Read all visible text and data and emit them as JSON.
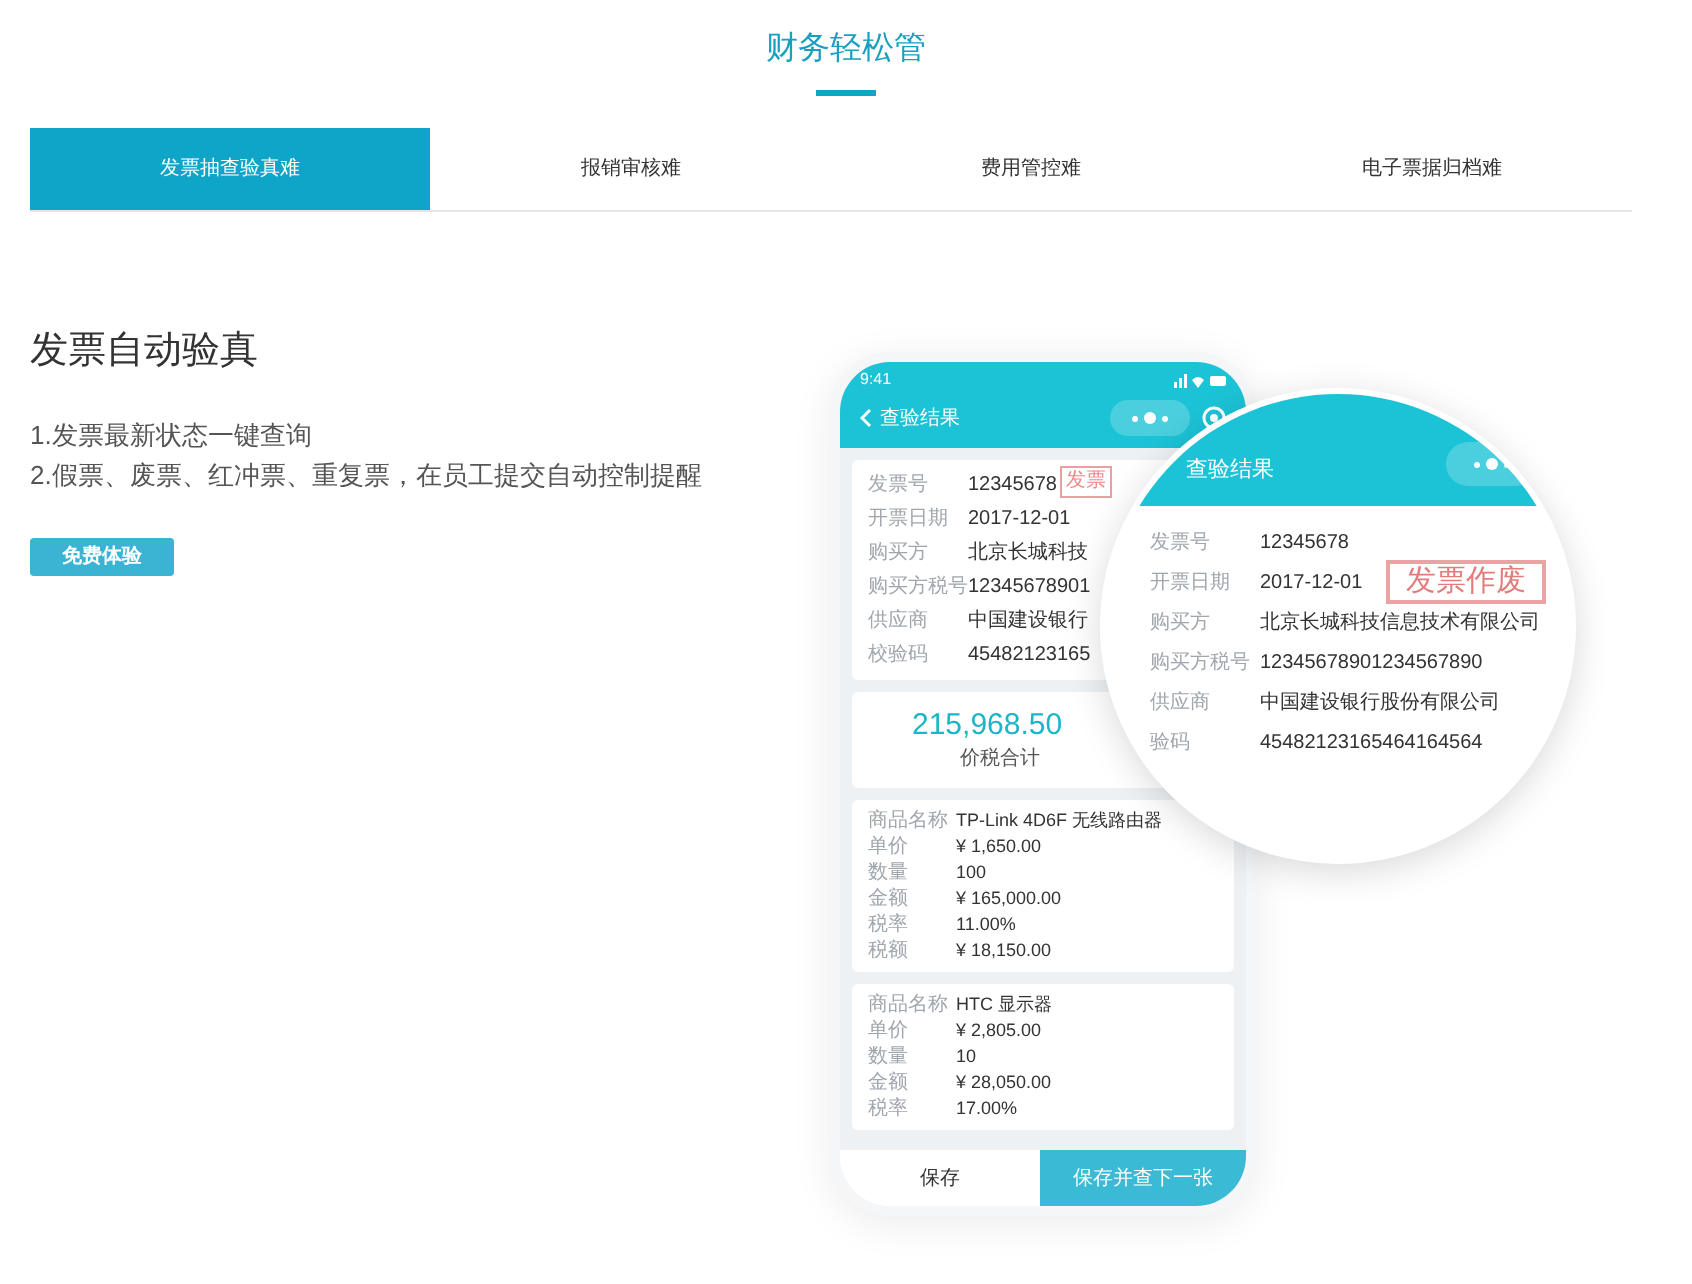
{
  "title": "财务轻松管",
  "tabs": [
    {
      "label": "发票抽查验真难",
      "selected": true
    },
    {
      "label": "报销审核难",
      "selected": false
    },
    {
      "label": "费用管控难",
      "selected": false
    },
    {
      "label": "电子票据归档难",
      "selected": false
    }
  ],
  "feature": {
    "heading": "发票自动验真",
    "points": [
      "1.发票最新状态一键查询",
      "2.假票、废票、红冲票、重复票，在员工提交自动控制提醒"
    ],
    "button": "免费体验"
  },
  "phone": {
    "time": "9:41",
    "header_title": "查验结果",
    "stamp": "发票",
    "invoice_fields": [
      {
        "label": "发票号",
        "value": "12345678"
      },
      {
        "label": "开票日期",
        "value": "2017-12-01"
      },
      {
        "label": "购买方",
        "value": "北京长城科技"
      },
      {
        "label": "购买方税号",
        "value": "12345678901"
      },
      {
        "label": "供应商",
        "value": "中国建设银行"
      },
      {
        "label": "校验码",
        "value": "45482123165"
      }
    ],
    "total": {
      "amount": "215,968.50",
      "label": "价税合计"
    },
    "items": [
      [
        {
          "label": "商品名称",
          "value": "TP-Link 4D6F 无线路由器"
        },
        {
          "label": "单价",
          "value": "¥ 1,650.00"
        },
        {
          "label": "数量",
          "value": "100"
        },
        {
          "label": "金额",
          "value": "¥ 165,000.00"
        },
        {
          "label": "税率",
          "value": "11.00%"
        },
        {
          "label": "税额",
          "value": "¥ 18,150.00"
        }
      ],
      [
        {
          "label": "商品名称",
          "value": "HTC 显示器"
        },
        {
          "label": "单价",
          "value": "¥ 2,805.00"
        },
        {
          "label": "数量",
          "value": "10"
        },
        {
          "label": "金额",
          "value": "¥ 28,050.00"
        },
        {
          "label": "税率",
          "value": "17.00%"
        }
      ]
    ],
    "save": "保存",
    "save_next": "保存并查下一张"
  },
  "magnifier": {
    "title": "查验结果",
    "stamp": "发票作废",
    "fields": [
      {
        "label": "发票号",
        "value": "12345678"
      },
      {
        "label": "开票日期",
        "value": "2017-12-01"
      },
      {
        "label": "购买方",
        "value": "北京长城科技信息技术有限公司"
      },
      {
        "label": "购买方税号",
        "value": "12345678901234567890"
      },
      {
        "label": "供应商",
        "value": "中国建设银行股份有限公司"
      },
      {
        "label": "验码",
        "value": "45482123165464164564"
      }
    ]
  }
}
